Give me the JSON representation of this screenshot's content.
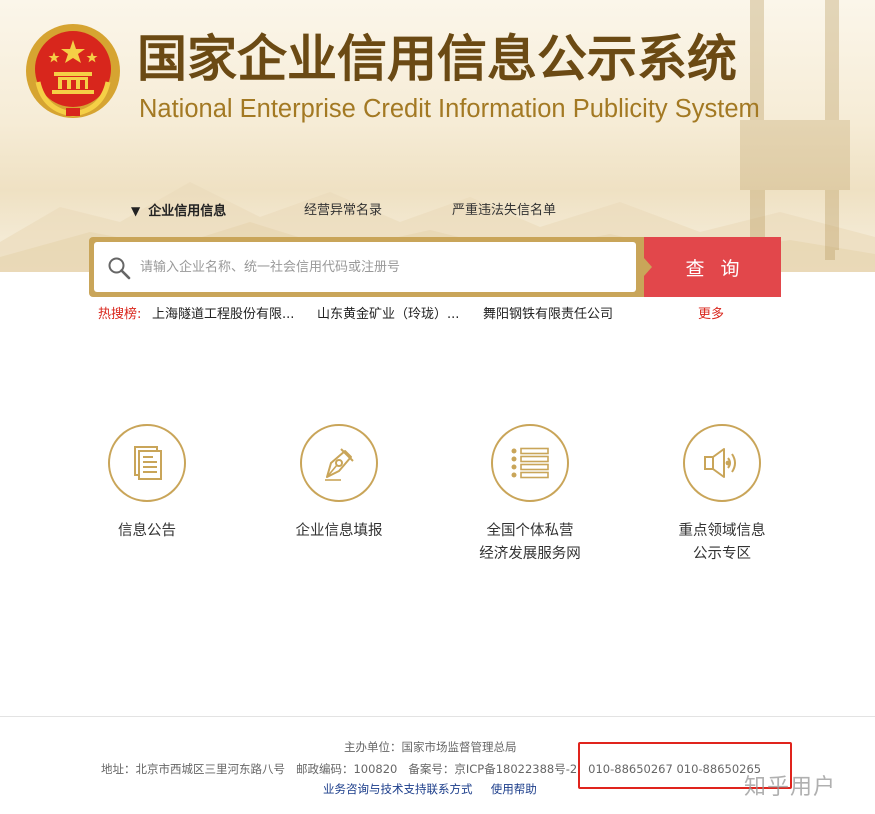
{
  "header": {
    "title_cn": "国家企业信用信息公示系统",
    "title_en": "National Enterprise Credit Information Publicity System",
    "emblem_icon": "national-emblem-icon"
  },
  "tabs": [
    {
      "label": "企业信用信息",
      "active": true
    },
    {
      "label": "经营异常名录",
      "active": false
    },
    {
      "label": "严重违法失信名单",
      "active": false
    }
  ],
  "search": {
    "placeholder": "请输入企业名称、统一社会信用代码或注册号",
    "value": "",
    "button_label": "查询"
  },
  "hot_search": {
    "label": "热搜榜:",
    "items": [
      "上海隧道工程股份有限...",
      "山东黄金矿业（玲珑）...",
      "舞阳钢铁有限责任公司"
    ],
    "more_label": "更多"
  },
  "features": [
    {
      "label": "信息公告",
      "icon": "document-icon"
    },
    {
      "label": "企业信息填报",
      "icon": "pen-icon"
    },
    {
      "label": "全国个体私营\n经济发展服务网",
      "icon": "list-icon"
    },
    {
      "label": "重点领域信息\n公示专区",
      "icon": "speaker-icon"
    }
  ],
  "footer": {
    "sponsor": "主办单位：国家市场监督管理总局",
    "address": "地址：北京市西城区三里河东路八号",
    "postcode": "邮政编码：100820",
    "icp": "备案号：京ICP备18022388号-2",
    "phones": "010-88650267 010-88650265",
    "link_support": "业务咨询与技术支持联系方式",
    "link_help": "使用帮助"
  },
  "watermark": "知乎用户",
  "colors": {
    "gold": "#c9a559",
    "title_brown": "#6b4a14",
    "search_red": "#e2474b",
    "hot_red": "#d9261c",
    "link_blue": "#1a3c8a",
    "highlight_red": "#e0241d"
  }
}
